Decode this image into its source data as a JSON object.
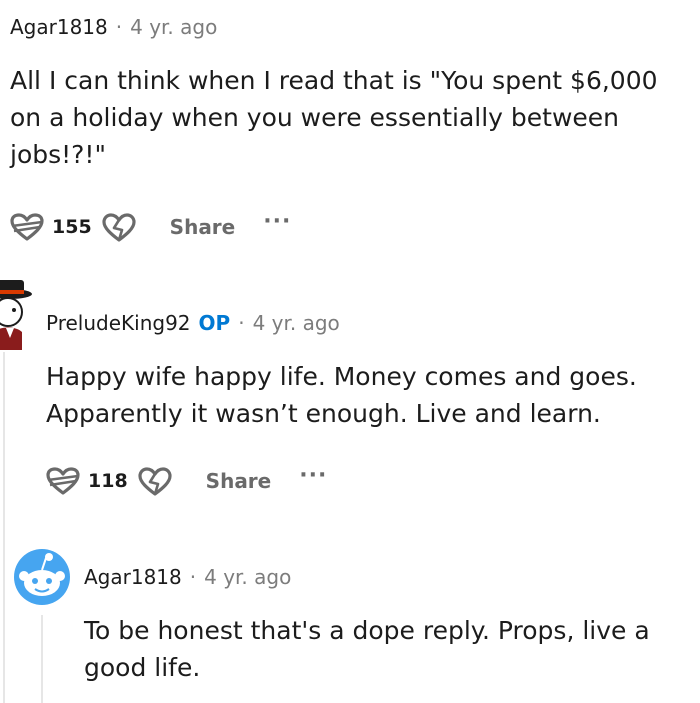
{
  "comments": [
    {
      "username": "Agar1818",
      "separator": "·",
      "time": "4 yr. ago",
      "text": "All I can think when I read that is \"You spent $6,000 on a holiday when you were essentially between jobs!?!\"",
      "votes": "155",
      "share_label": "Share",
      "more_label": "···"
    },
    {
      "username": "PreludeKing92",
      "op_badge": "OP",
      "separator": "·",
      "time": "4 yr. ago",
      "text": "Happy wife happy life. Money comes and goes. Apparently it wasn’t enough. Live and learn.",
      "votes": "118",
      "share_label": "Share",
      "more_label": "···"
    },
    {
      "username": "Agar1818",
      "separator": "·",
      "time": "4 yr. ago",
      "text": "To be honest that's a dope reply. Props, live a good life."
    }
  ],
  "icons": {
    "upvote": "upvote-heart-icon",
    "downvote": "downvote-heart-icon"
  },
  "colors": {
    "op": "#0079d3",
    "meta": "#7c7c7c",
    "action": "#6a6a6a"
  }
}
